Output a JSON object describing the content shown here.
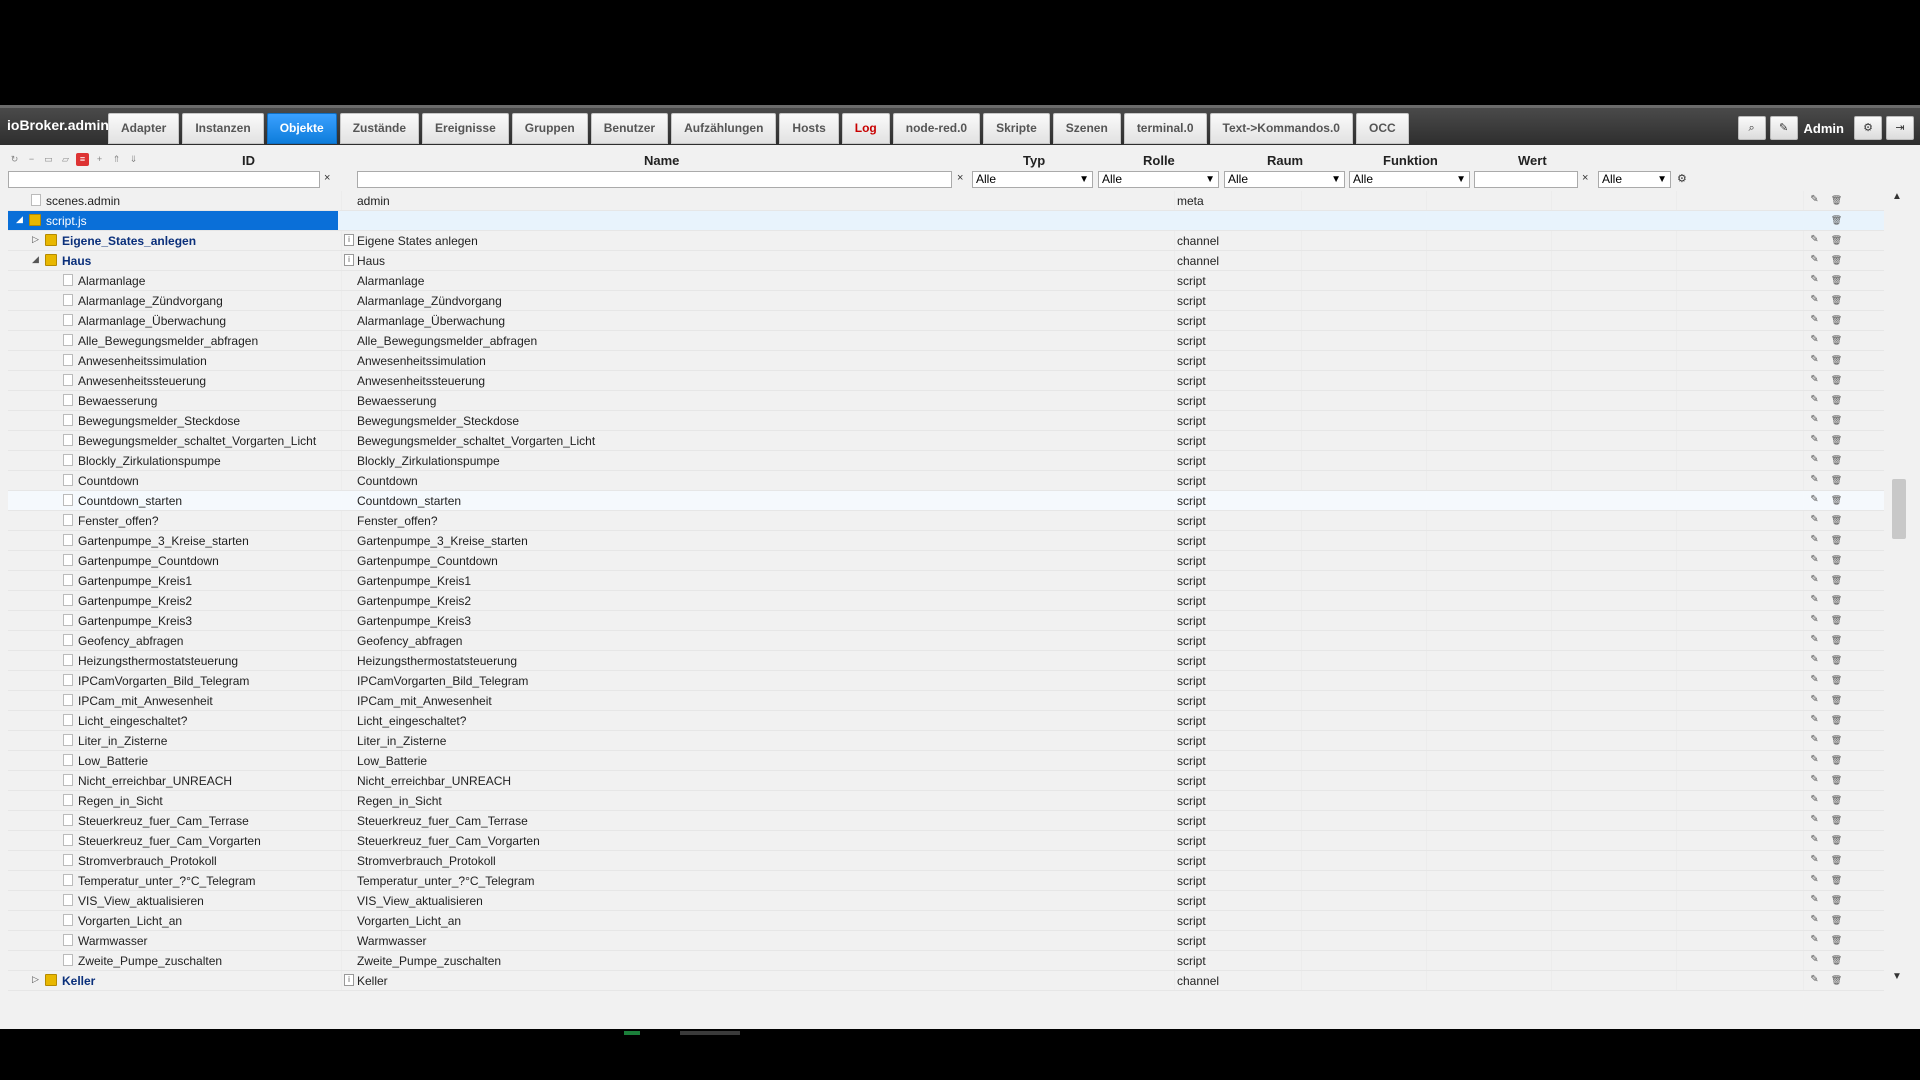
{
  "app": {
    "brand": "ioBroker.admin",
    "user": "Admin"
  },
  "tabs": [
    {
      "label": "Adapter"
    },
    {
      "label": "Instanzen"
    },
    {
      "label": "Objekte"
    },
    {
      "label": "Zustände"
    },
    {
      "label": "Ereignisse"
    },
    {
      "label": "Gruppen"
    },
    {
      "label": "Benutzer"
    },
    {
      "label": "Aufzählungen"
    },
    {
      "label": "Hosts"
    },
    {
      "label": "Log"
    },
    {
      "label": "node-red.0"
    },
    {
      "label": "Skripte"
    },
    {
      "label": "Szenen"
    },
    {
      "label": "terminal.0"
    },
    {
      "label": "Text->Kommandos.0"
    },
    {
      "label": "OCC"
    }
  ],
  "active_tab": "Objekte",
  "columns": {
    "id": "ID",
    "name": "Name",
    "typ": "Typ",
    "rolle": "Rolle",
    "raum": "Raum",
    "funktion": "Funktion",
    "wert": "Wert"
  },
  "filters": {
    "typ": "Alle",
    "rolle": "Alle",
    "raum": "Alle",
    "funktion": "Alle",
    "wert_select": "Alle",
    "clear": "×"
  },
  "icons": {
    "edit": "pencil-icon",
    "delete": "trash-icon"
  },
  "rows": [
    {
      "id": "scenes.admin",
      "name": "admin",
      "type": "meta",
      "kind": "file",
      "level": 0
    },
    {
      "id": "script.js",
      "name": "",
      "type": "",
      "kind": "folder",
      "level": 0,
      "expanded": true,
      "selected": true
    },
    {
      "id": "Eigene_States_anlegen",
      "name": "Eigene States anlegen",
      "type": "channel",
      "kind": "folder",
      "level": 1,
      "expanded": false
    },
    {
      "id": "Haus",
      "name": "Haus",
      "type": "channel",
      "kind": "folder",
      "level": 1,
      "expanded": true
    },
    {
      "id": "Alarmanlage",
      "name": "Alarmanlage",
      "type": "script",
      "kind": "file",
      "level": 2
    },
    {
      "id": "Alarmanlage_Zündvorgang",
      "name": "Alarmanlage_Zündvorgang",
      "type": "script",
      "kind": "file",
      "level": 2
    },
    {
      "id": "Alarmanlage_Überwachung",
      "name": "Alarmanlage_Überwachung",
      "type": "script",
      "kind": "file",
      "level": 2
    },
    {
      "id": "Alle_Bewegungsmelder_abfragen",
      "name": "Alle_Bewegungsmelder_abfragen",
      "type": "script",
      "kind": "file",
      "level": 2
    },
    {
      "id": "Anwesenheitssimulation",
      "name": "Anwesenheitssimulation",
      "type": "script",
      "kind": "file",
      "level": 2
    },
    {
      "id": "Anwesenheitssteuerung",
      "name": "Anwesenheitssteuerung",
      "type": "script",
      "kind": "file",
      "level": 2
    },
    {
      "id": "Bewaesserung",
      "name": "Bewaesserung",
      "type": "script",
      "kind": "file",
      "level": 2
    },
    {
      "id": "Bewegungsmelder_Steckdose",
      "name": "Bewegungsmelder_Steckdose",
      "type": "script",
      "kind": "file",
      "level": 2
    },
    {
      "id": "Bewegungsmelder_schaltet_Vorgarten_Licht",
      "name": "Bewegungsmelder_schaltet_Vorgarten_Licht",
      "type": "script",
      "kind": "file",
      "level": 2
    },
    {
      "id": "Blockly_Zirkulationspumpe",
      "name": "Blockly_Zirkulationspumpe",
      "type": "script",
      "kind": "file",
      "level": 2
    },
    {
      "id": "Countdown",
      "name": "Countdown",
      "type": "script",
      "kind": "file",
      "level": 2
    },
    {
      "id": "Countdown_starten",
      "name": "Countdown_starten",
      "type": "script",
      "kind": "file",
      "level": 2,
      "hover": true
    },
    {
      "id": "Fenster_offen?",
      "name": "Fenster_offen?",
      "type": "script",
      "kind": "file",
      "level": 2
    },
    {
      "id": "Gartenpumpe_3_Kreise_starten",
      "name": "Gartenpumpe_3_Kreise_starten",
      "type": "script",
      "kind": "file",
      "level": 2
    },
    {
      "id": "Gartenpumpe_Countdown",
      "name": "Gartenpumpe_Countdown",
      "type": "script",
      "kind": "file",
      "level": 2
    },
    {
      "id": "Gartenpumpe_Kreis1",
      "name": "Gartenpumpe_Kreis1",
      "type": "script",
      "kind": "file",
      "level": 2
    },
    {
      "id": "Gartenpumpe_Kreis2",
      "name": "Gartenpumpe_Kreis2",
      "type": "script",
      "kind": "file",
      "level": 2
    },
    {
      "id": "Gartenpumpe_Kreis3",
      "name": "Gartenpumpe_Kreis3",
      "type": "script",
      "kind": "file",
      "level": 2
    },
    {
      "id": "Geofency_abfragen",
      "name": "Geofency_abfragen",
      "type": "script",
      "kind": "file",
      "level": 2
    },
    {
      "id": "Heizungsthermostatsteuerung",
      "name": "Heizungsthermostatsteuerung",
      "type": "script",
      "kind": "file",
      "level": 2
    },
    {
      "id": "IPCamVorgarten_Bild_Telegram",
      "name": "IPCamVorgarten_Bild_Telegram",
      "type": "script",
      "kind": "file",
      "level": 2
    },
    {
      "id": "IPCam_mit_Anwesenheit",
      "name": "IPCam_mit_Anwesenheit",
      "type": "script",
      "kind": "file",
      "level": 2
    },
    {
      "id": "Licht_eingeschaltet?",
      "name": "Licht_eingeschaltet?",
      "type": "script",
      "kind": "file",
      "level": 2
    },
    {
      "id": "Liter_in_Zisterne",
      "name": "Liter_in_Zisterne",
      "type": "script",
      "kind": "file",
      "level": 2
    },
    {
      "id": "Low_Batterie",
      "name": "Low_Batterie",
      "type": "script",
      "kind": "file",
      "level": 2
    },
    {
      "id": "Nicht_erreichbar_UNREACH",
      "name": "Nicht_erreichbar_UNREACH",
      "type": "script",
      "kind": "file",
      "level": 2
    },
    {
      "id": "Regen_in_Sicht",
      "name": "Regen_in_Sicht",
      "type": "script",
      "kind": "file",
      "level": 2
    },
    {
      "id": "Steuerkreuz_fuer_Cam_Terrase",
      "name": "Steuerkreuz_fuer_Cam_Terrase",
      "type": "script",
      "kind": "file",
      "level": 2
    },
    {
      "id": "Steuerkreuz_fuer_Cam_Vorgarten",
      "name": "Steuerkreuz_fuer_Cam_Vorgarten",
      "type": "script",
      "kind": "file",
      "level": 2
    },
    {
      "id": "Stromverbrauch_Protokoll",
      "name": "Stromverbrauch_Protokoll",
      "type": "script",
      "kind": "file",
      "level": 2
    },
    {
      "id": "Temperatur_unter_?°C_Telegram",
      "name": "Temperatur_unter_?°C_Telegram",
      "type": "script",
      "kind": "file",
      "level": 2
    },
    {
      "id": "VIS_View_aktualisieren",
      "name": "VIS_View_aktualisieren",
      "type": "script",
      "kind": "file",
      "level": 2
    },
    {
      "id": "Vorgarten_Licht_an",
      "name": "Vorgarten_Licht_an",
      "type": "script",
      "kind": "file",
      "level": 2
    },
    {
      "id": "Warmwasser",
      "name": "Warmwasser",
      "type": "script",
      "kind": "file",
      "level": 2
    },
    {
      "id": "Zweite_Pumpe_zuschalten",
      "name": "Zweite_Pumpe_zuschalten",
      "type": "script",
      "kind": "file",
      "level": 2
    },
    {
      "id": "Keller",
      "name": "Keller",
      "type": "channel",
      "kind": "folder",
      "level": 1,
      "expanded": false
    }
  ]
}
